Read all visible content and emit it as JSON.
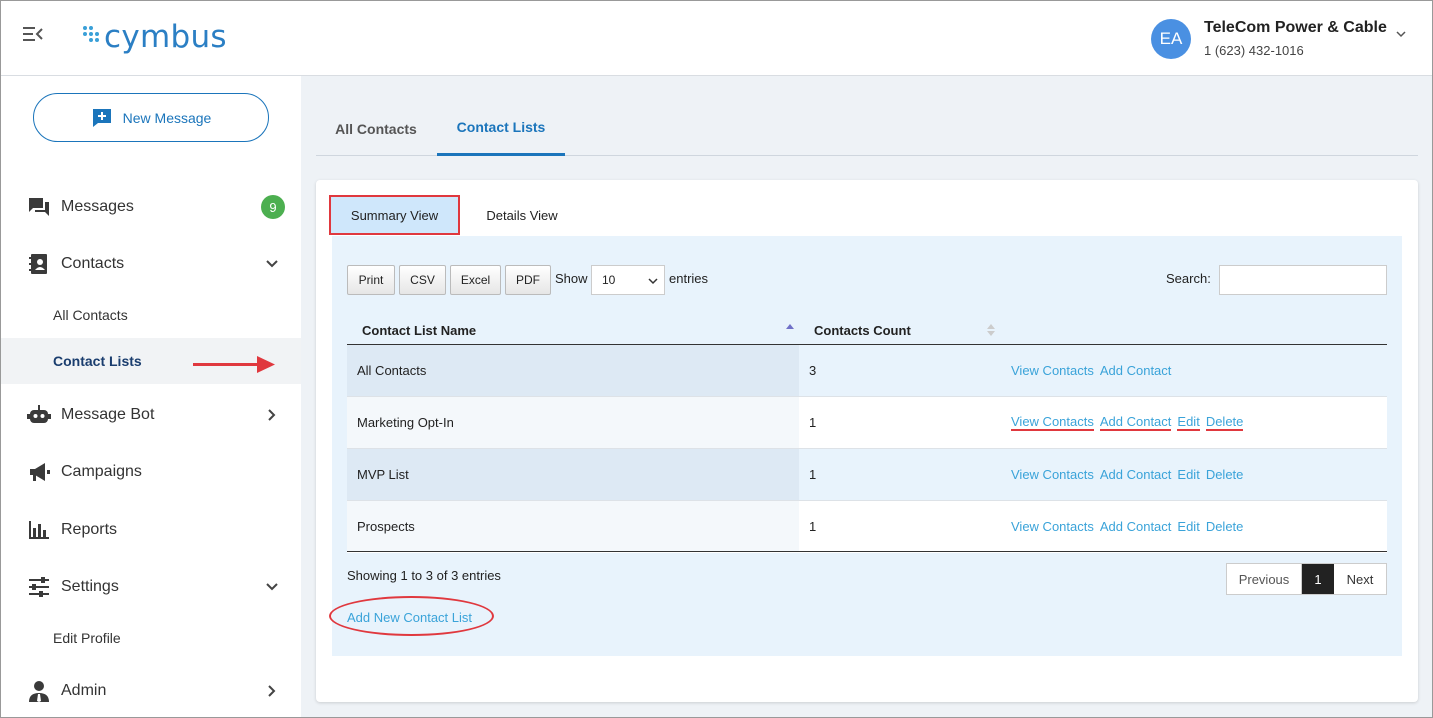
{
  "header": {
    "brand": "cymbus",
    "avatar_initials": "EA",
    "account_name": "TeleCom Power & Cable",
    "account_phone": "1 (623) 432-1016"
  },
  "sidebar": {
    "new_message_label": "New Message",
    "items": {
      "messages": {
        "label": "Messages",
        "badge": "9"
      },
      "contacts": {
        "label": "Contacts"
      },
      "all_contacts": {
        "label": "All Contacts"
      },
      "contact_lists": {
        "label": "Contact Lists"
      },
      "message_bot": {
        "label": "Message Bot"
      },
      "campaigns": {
        "label": "Campaigns"
      },
      "reports": {
        "label": "Reports"
      },
      "settings": {
        "label": "Settings"
      },
      "edit_profile": {
        "label": "Edit Profile"
      },
      "admin": {
        "label": "Admin"
      }
    }
  },
  "main_tabs": {
    "all_contacts": "All Contacts",
    "contact_lists": "Contact Lists"
  },
  "view_tabs": {
    "summary": "Summary View",
    "details": "Details View"
  },
  "toolbar": {
    "print": "Print",
    "csv": "CSV",
    "excel": "Excel",
    "pdf": "PDF",
    "show": "Show",
    "entries_value": "10",
    "entries": "entries",
    "search_label": "Search:",
    "search_value": ""
  },
  "table": {
    "columns": {
      "name": "Contact List Name",
      "count": "Contacts Count"
    },
    "rows": [
      {
        "name": "All Contacts",
        "count": "3",
        "view": "View Contacts",
        "add": "Add Contact",
        "edit": "",
        "delete": ""
      },
      {
        "name": "Marketing Opt-In",
        "count": "1",
        "view": "View Contacts",
        "add": "Add Contact",
        "edit": "Edit",
        "delete": "Delete"
      },
      {
        "name": "MVP List",
        "count": "1",
        "view": "View Contacts",
        "add": "Add Contact",
        "edit": "Edit",
        "delete": "Delete"
      },
      {
        "name": "Prospects",
        "count": "1",
        "view": "View Contacts",
        "add": "Add Contact",
        "edit": "Edit",
        "delete": "Delete"
      }
    ]
  },
  "footer": {
    "info": "Showing 1 to 3 of 3 entries",
    "previous": "Previous",
    "page": "1",
    "next": "Next",
    "add_new": "Add New Contact List"
  },
  "colors": {
    "accent": "#1b75bb",
    "link": "#3aa3d9",
    "highlight": "#e0383e",
    "badge": "#4caf50"
  }
}
